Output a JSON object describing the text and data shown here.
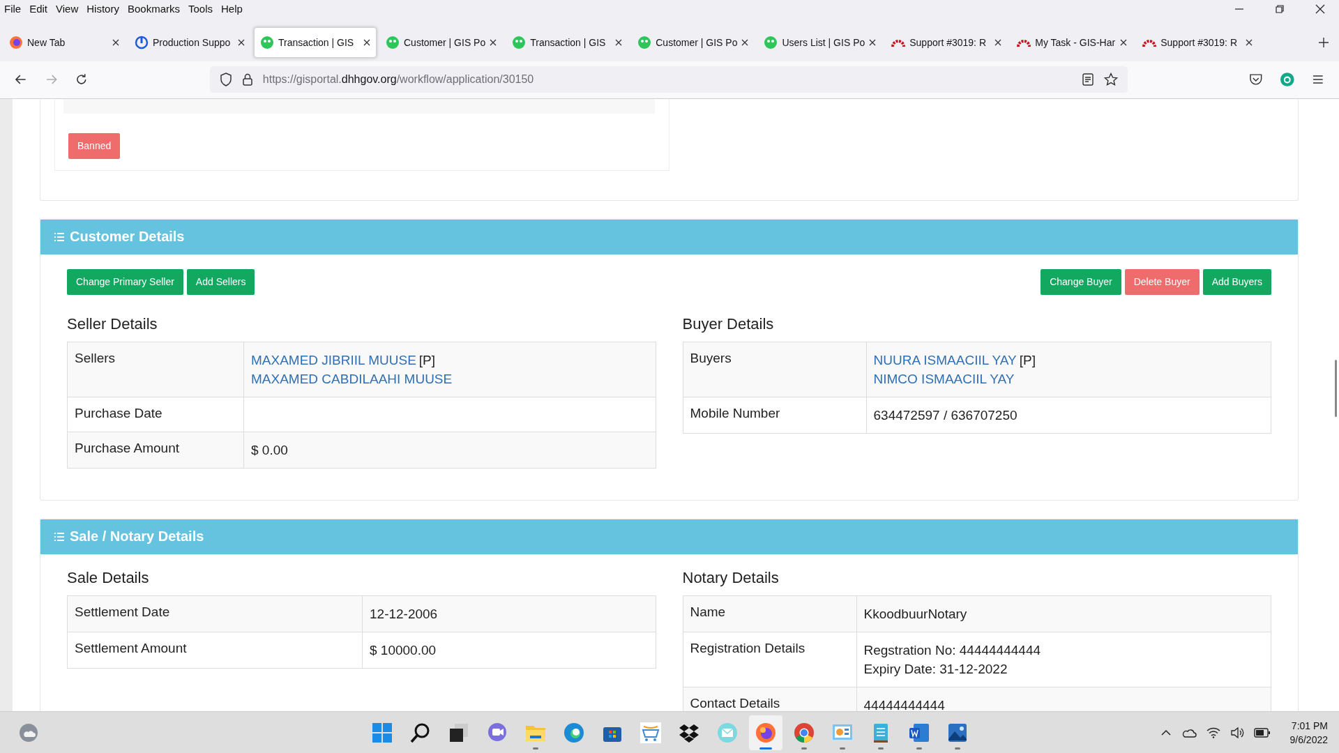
{
  "browser": {
    "menu": [
      "File",
      "Edit",
      "View",
      "History",
      "Bookmarks",
      "Tools",
      "Help"
    ],
    "tabs": [
      {
        "title": "New Tab",
        "kind": "firefox",
        "selected": false
      },
      {
        "title": "Production Suppo",
        "kind": "blue",
        "selected": false
      },
      {
        "title": "Transaction | GIS",
        "kind": "gis",
        "selected": true
      },
      {
        "title": "Customer | GIS Po",
        "kind": "gis",
        "selected": false
      },
      {
        "title": "Transaction | GIS",
        "kind": "gis",
        "selected": false
      },
      {
        "title": "Customer | GIS Po",
        "kind": "gis",
        "selected": false
      },
      {
        "title": "Users List | GIS Po",
        "kind": "gis",
        "selected": false
      },
      {
        "title": "Support #3019: R",
        "kind": "redmine",
        "selected": false
      },
      {
        "title": "My Task - GIS-Har",
        "kind": "redmine",
        "selected": false
      },
      {
        "title": "Support #3019: R",
        "kind": "redmine",
        "selected": false
      }
    ],
    "url": {
      "prefix": "https://gisportal.",
      "domain": "dhhgov.org",
      "path": "/workflow/application/30150"
    }
  },
  "page": {
    "top_card": {
      "button": {
        "label": "Banned",
        "kind": "danger"
      }
    },
    "sections": [
      {
        "title": "Customer Details",
        "buttons_left": [
          {
            "label": "Change Primary Seller",
            "kind": "success"
          },
          {
            "label": "Add Sellers",
            "kind": "success"
          }
        ],
        "buttons_right": [
          {
            "label": "Change Buyer",
            "kind": "success"
          },
          {
            "label": "Delete Buyer",
            "kind": "danger"
          },
          {
            "label": "Add Buyers",
            "kind": "success"
          }
        ],
        "panels": [
          {
            "title": "Seller Details",
            "rows": [
              {
                "label": "Sellers",
                "lines": [
                  {
                    "text": "MAXAMED JIBRIIL MUUSE",
                    "link": true,
                    "tag": "[P]"
                  },
                  {
                    "text": "MAXAMED CABDILAAHI MUUSE",
                    "link": true
                  }
                ]
              },
              {
                "label": "Purchase Date",
                "lines": []
              },
              {
                "label": "Purchase Amount",
                "lines": [
                  {
                    "text": "$ 0.00",
                    "link": false
                  }
                ]
              }
            ]
          },
          {
            "title": "Buyer Details",
            "rows": [
              {
                "label": "Buyers",
                "lines": [
                  {
                    "text": "NUURA ISMAACIIL YAY",
                    "link": true,
                    "tag": "[P]"
                  },
                  {
                    "text": "NIMCO ISMAACIIL YAY",
                    "link": true
                  }
                ]
              },
              {
                "label": "Mobile Number",
                "lines": [
                  {
                    "text": "634472597 / 636707250",
                    "link": false
                  }
                ]
              }
            ]
          }
        ]
      },
      {
        "title": "Sale / Notary Details",
        "panels": [
          {
            "title": "Sale Details",
            "rows": [
              {
                "label": "Settlement Date",
                "lines": [
                  {
                    "text": "12-12-2006",
                    "link": false
                  }
                ]
              },
              {
                "label": "Settlement Amount",
                "lines": [
                  {
                    "text": "$ 10000.00",
                    "link": false
                  }
                ]
              }
            ]
          },
          {
            "title": "Notary Details",
            "rows": [
              {
                "label": "Name",
                "lines": [
                  {
                    "text": "KkoodbuurNotary",
                    "link": false
                  }
                ]
              },
              {
                "label": "Registration Details",
                "lines": [
                  {
                    "text": "Regstration No: 44444444444",
                    "link": false
                  },
                  {
                    "text": "Expiry Date: 31-12-2022",
                    "link": false
                  }
                ]
              },
              {
                "label": "Contact Details",
                "lines": [
                  {
                    "text": "44444444444",
                    "link": false
                  }
                ]
              }
            ]
          }
        ]
      }
    ]
  },
  "taskbar": {
    "apps": [
      {
        "kind": "start",
        "running": false,
        "active": false
      },
      {
        "kind": "search",
        "running": false,
        "active": false
      },
      {
        "kind": "taskview",
        "running": false,
        "active": false
      },
      {
        "kind": "chat",
        "running": false,
        "active": false
      },
      {
        "kind": "folder",
        "running": true,
        "active": false
      },
      {
        "kind": "edge",
        "running": false,
        "active": false
      },
      {
        "kind": "store",
        "running": false,
        "active": false
      },
      {
        "kind": "cart",
        "running": false,
        "active": false
      },
      {
        "kind": "dropbox",
        "running": false,
        "active": false
      },
      {
        "kind": "mail",
        "running": false,
        "active": false
      },
      {
        "kind": "firefox",
        "running": true,
        "active": true
      },
      {
        "kind": "chrome",
        "running": true,
        "active": false
      },
      {
        "kind": "chart",
        "running": true,
        "active": false
      },
      {
        "kind": "notepad",
        "running": true,
        "active": false
      },
      {
        "kind": "word",
        "running": true,
        "active": false
      },
      {
        "kind": "photos",
        "running": true,
        "active": false
      }
    ],
    "time": "7:01 PM",
    "date": "9/6/2022"
  }
}
